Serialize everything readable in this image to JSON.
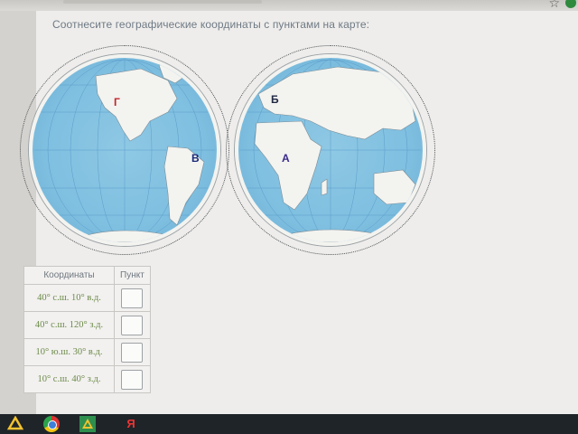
{
  "question": "Соотнесите географические координаты с пунктами на карте:",
  "map": {
    "points": {
      "g": "Г",
      "b": "Б",
      "v": "В",
      "a": "А"
    }
  },
  "table": {
    "headers": [
      "Координаты",
      "Пункт"
    ],
    "rows": [
      "40° с.ш. 10° в.д.",
      "40° с.ш. 120° з.д.",
      "10° ю.ш. 30° в.д.",
      "10° с.ш. 40° з.д."
    ]
  },
  "colors": {
    "ocean": "#8ec8e4",
    "land": "#f3f3f0",
    "coord_text": "#6c8a4a",
    "point_g": "#c0262a"
  },
  "icons": {
    "bookmark": "star-icon",
    "taskbar": [
      "google-drive-icon",
      "chrome-icon",
      "google-drive-icon",
      "yandex-icon"
    ]
  }
}
